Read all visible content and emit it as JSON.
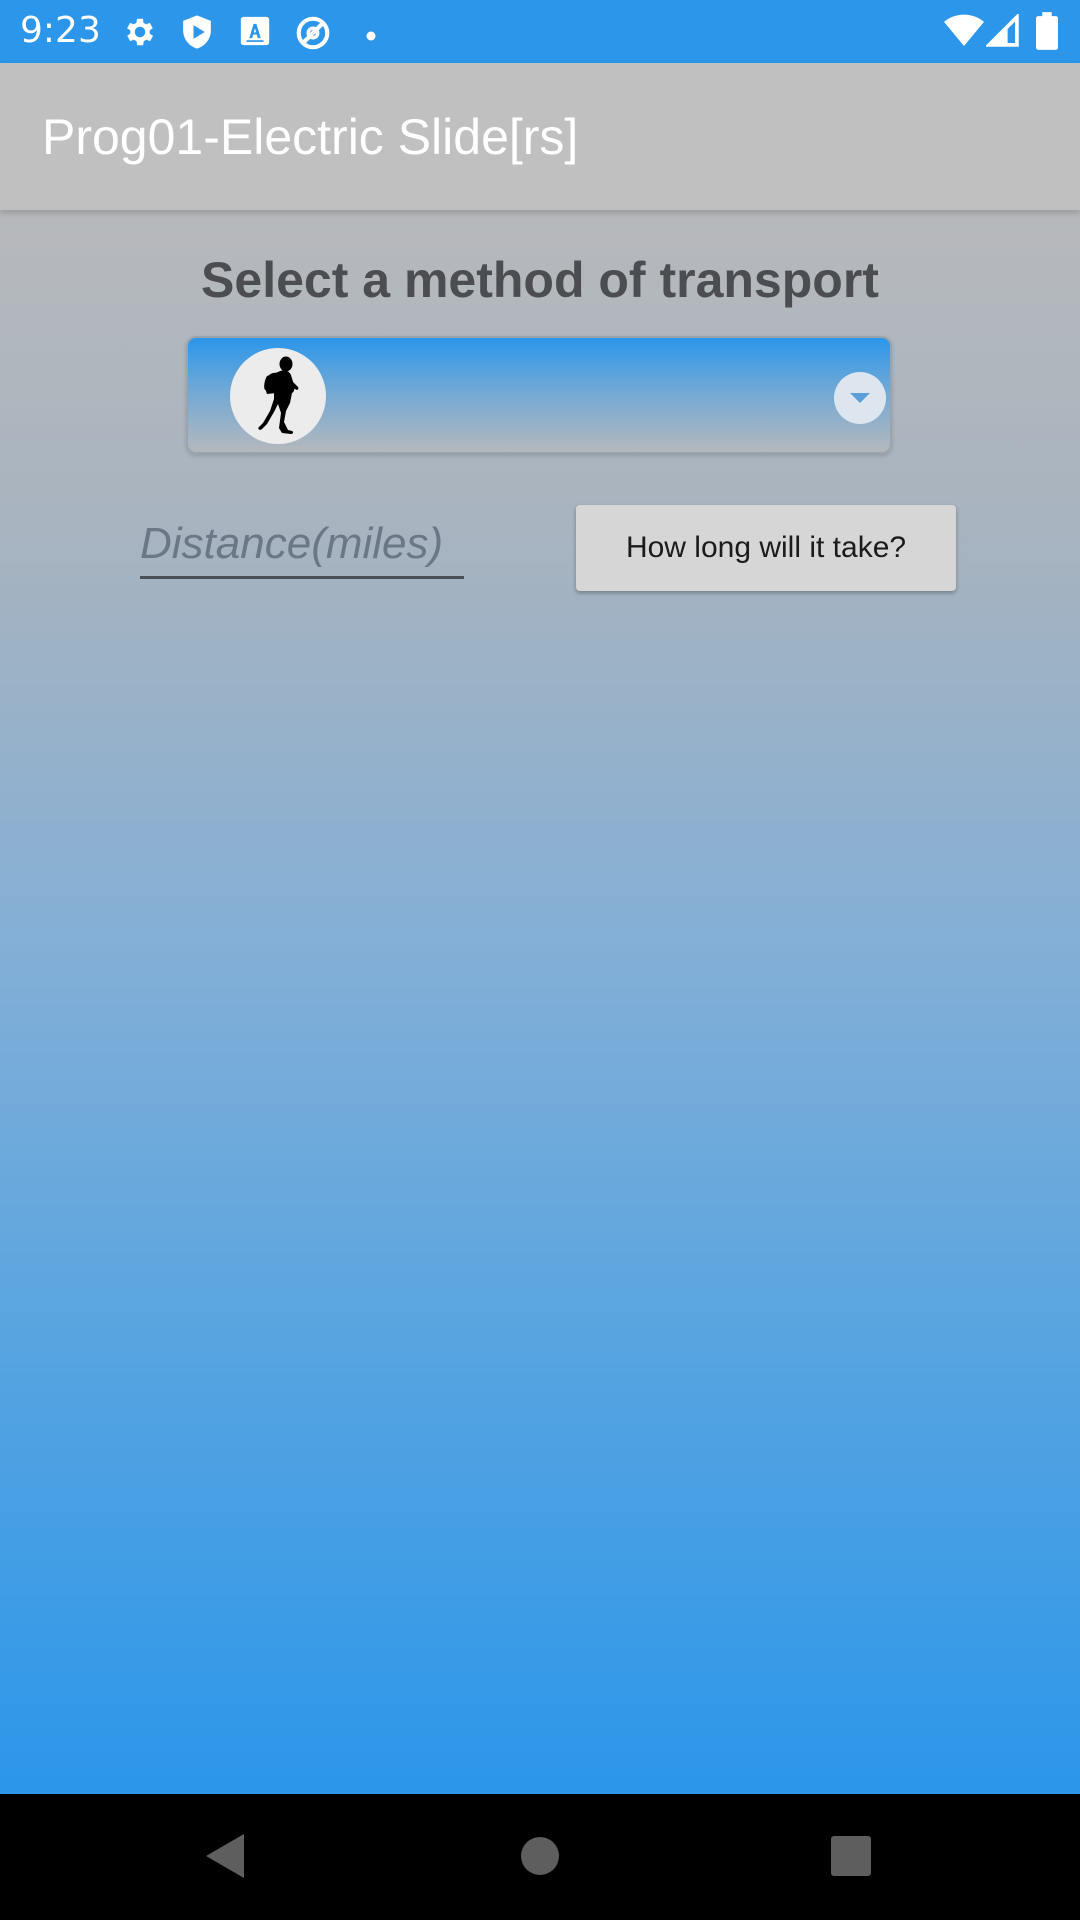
{
  "status_bar": {
    "time": "9:23",
    "left_icons": [
      "gear-icon",
      "shield-play-icon",
      "text-box-icon",
      "no-sign-icon",
      "dot-icon"
    ],
    "right_icons": [
      "wifi-icon",
      "signal-icon",
      "battery-icon"
    ]
  },
  "app_bar": {
    "title": "Prog01-Electric Slide[rs]"
  },
  "main": {
    "heading": "Select a method of transport",
    "transport_spinner": {
      "selected_icon": "walking-person-icon"
    },
    "distance_placeholder": "Distance(miles)",
    "distance_value": "",
    "calc_button_label": "How long will it take?"
  },
  "nav_bar": {
    "buttons": [
      "back-icon",
      "home-icon",
      "recents-icon"
    ]
  },
  "colors": {
    "status_bar": "#2b96ea",
    "app_bar": "#c0c0c0",
    "gradient_top": "#b7b9bc",
    "gradient_bottom": "#2b96ea",
    "heading_text": "#4b4d50",
    "button_bg": "#d6d6d6"
  }
}
